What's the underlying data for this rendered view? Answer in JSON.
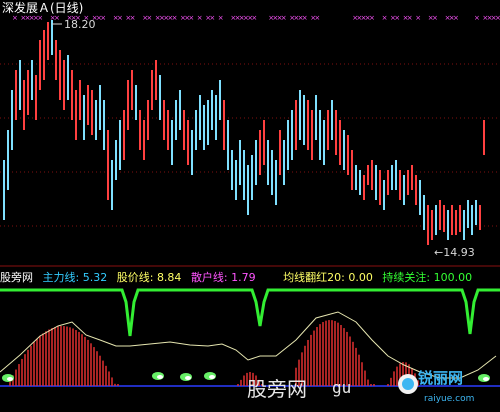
{
  "window": {
    "title": "深发展Ａ(日线)"
  },
  "price_panel": {
    "high_label": "18.20",
    "low_label": "←14.93",
    "colors": {
      "up": "#ff4040",
      "down": "#7fe0ff",
      "marker": "#ff55ff",
      "grid": "#7f1010"
    }
  },
  "indicator_panel": {
    "name": "股旁网",
    "items": [
      {
        "label": "主力线:",
        "value": "5.32",
        "color": "#33ccff"
      },
      {
        "label": "股价线:",
        "value": "8.84",
        "color": "#ffff66"
      },
      {
        "label": "散户线:",
        "value": "1.79",
        "color": "#ff55ff"
      },
      {
        "label": "均线翻红20:",
        "value": "0.00",
        "color": "#ffff66"
      },
      {
        "label": "持续关注:",
        "value": "100.00",
        "color": "#33ff33"
      }
    ]
  },
  "watermark": {
    "text1": "股旁网",
    "text2": "gu",
    "text3": "锐丽网",
    "text4": "raiyue.com"
  },
  "chart_data": {
    "type": "candlestick",
    "high_marked": 18.2,
    "low_marked": 14.93
  }
}
